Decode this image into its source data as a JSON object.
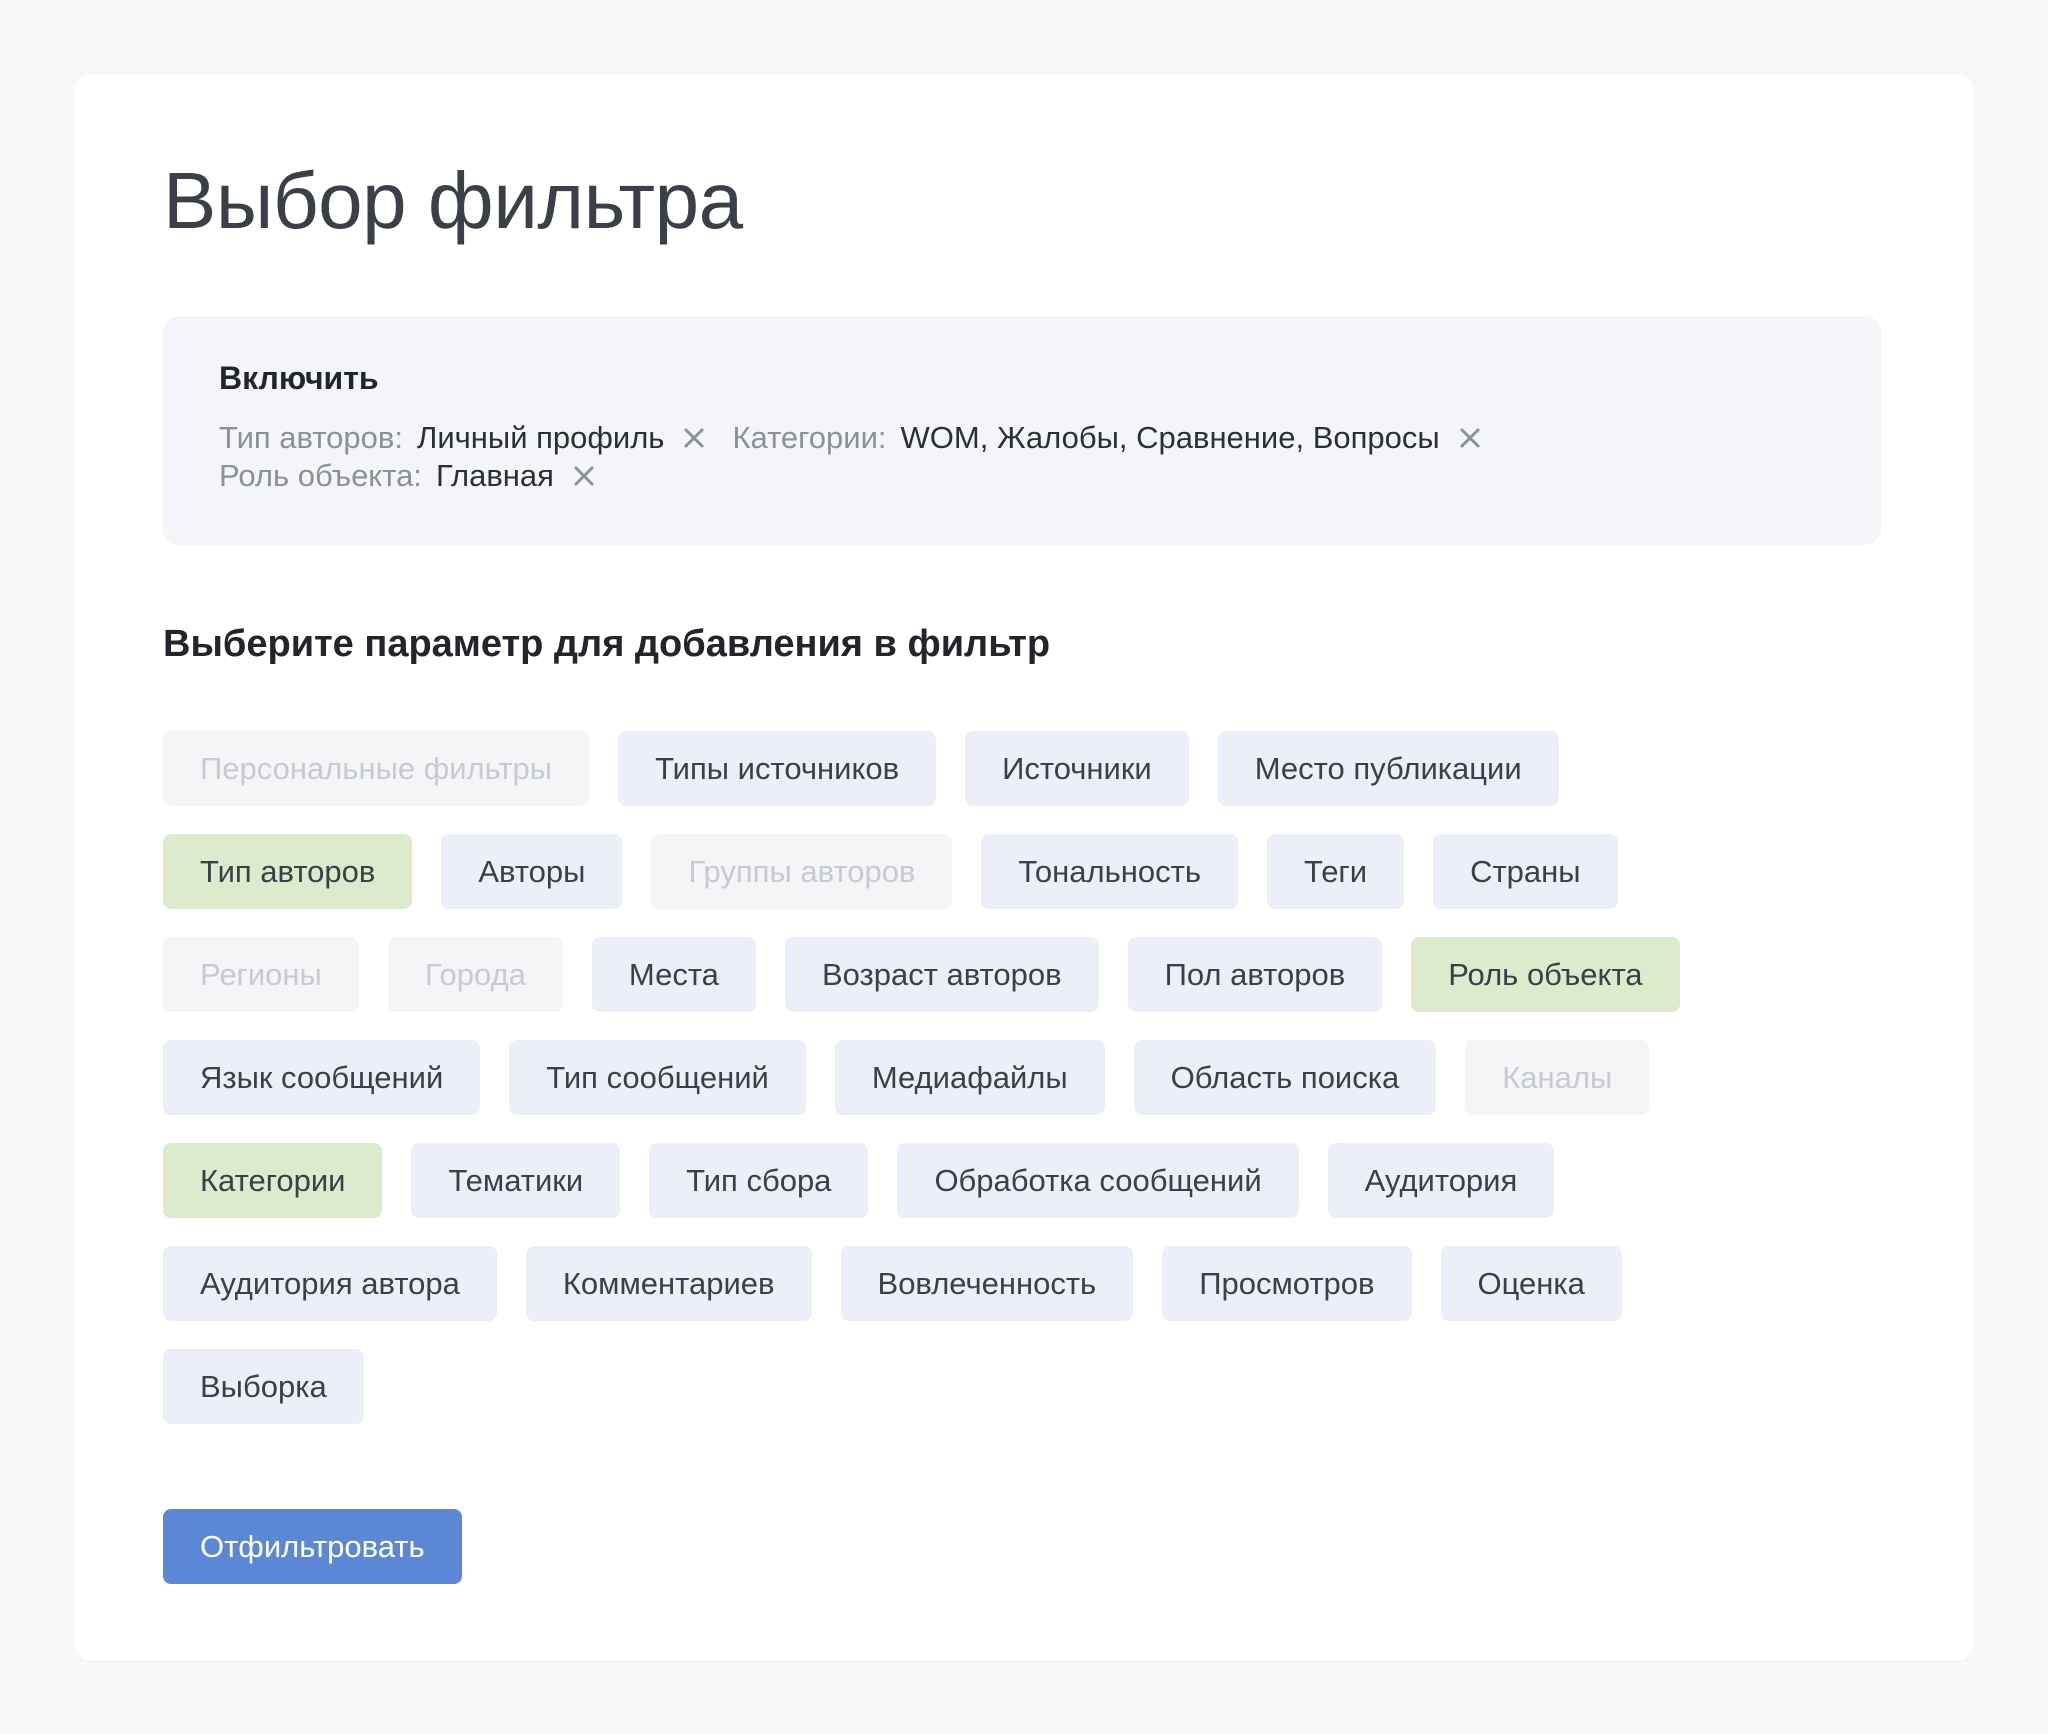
{
  "page_title": "Выбор фильтра",
  "include": {
    "title": "Включить",
    "filters": [
      {
        "label": "Тип авторов:",
        "value": "Личный профиль"
      },
      {
        "label": "Категории:",
        "value": "WOM, Жалобы, Сравнение, Вопросы"
      },
      {
        "label": "Роль объекта:",
        "value": "Главная"
      }
    ]
  },
  "section_title": "Выберите параметр для добавления в фильтр",
  "chip_rows": [
    [
      {
        "label": "Персональные фильтры",
        "state": "disabled"
      },
      {
        "label": "Типы источников",
        "state": "default"
      },
      {
        "label": "Источники",
        "state": "default"
      },
      {
        "label": "Место публикации",
        "state": "default"
      }
    ],
    [
      {
        "label": "Тип авторов",
        "state": "active"
      },
      {
        "label": "Авторы",
        "state": "default"
      },
      {
        "label": "Группы авторов",
        "state": "disabled"
      },
      {
        "label": "Тональность",
        "state": "default"
      },
      {
        "label": "Теги",
        "state": "default"
      },
      {
        "label": "Страны",
        "state": "default"
      }
    ],
    [
      {
        "label": "Регионы",
        "state": "disabled"
      },
      {
        "label": "Города",
        "state": "disabled"
      },
      {
        "label": "Места",
        "state": "default"
      },
      {
        "label": "Возраст авторов",
        "state": "default"
      },
      {
        "label": "Пол авторов",
        "state": "default"
      },
      {
        "label": "Роль объекта",
        "state": "active"
      }
    ],
    [
      {
        "label": "Язык сообщений",
        "state": "default"
      },
      {
        "label": "Тип сообщений",
        "state": "default"
      },
      {
        "label": "Медиафайлы",
        "state": "default"
      },
      {
        "label": "Область поиска",
        "state": "default"
      },
      {
        "label": "Каналы",
        "state": "disabled"
      }
    ],
    [
      {
        "label": "Категории",
        "state": "active"
      },
      {
        "label": "Тематики",
        "state": "default"
      },
      {
        "label": "Тип сбора",
        "state": "default"
      },
      {
        "label": "Обработка сообщений",
        "state": "default"
      },
      {
        "label": "Аудитория",
        "state": "default"
      }
    ],
    [
      {
        "label": "Аудитория автора",
        "state": "default"
      },
      {
        "label": "Комментариев",
        "state": "default"
      },
      {
        "label": "Вовлеченность",
        "state": "default"
      },
      {
        "label": "Просмотров",
        "state": "default"
      },
      {
        "label": "Оценка",
        "state": "default"
      }
    ],
    [
      {
        "label": "Выборка",
        "state": "default"
      }
    ]
  ],
  "submit_label": "Отфильтровать",
  "icons": {
    "remove": "close-icon"
  },
  "colors": {
    "background": "#f6f7f9",
    "chip_default": "#eceff8",
    "chip_active": "#dcebcb",
    "chip_disabled": "#f4f5f7",
    "button": "#5b87d6"
  }
}
